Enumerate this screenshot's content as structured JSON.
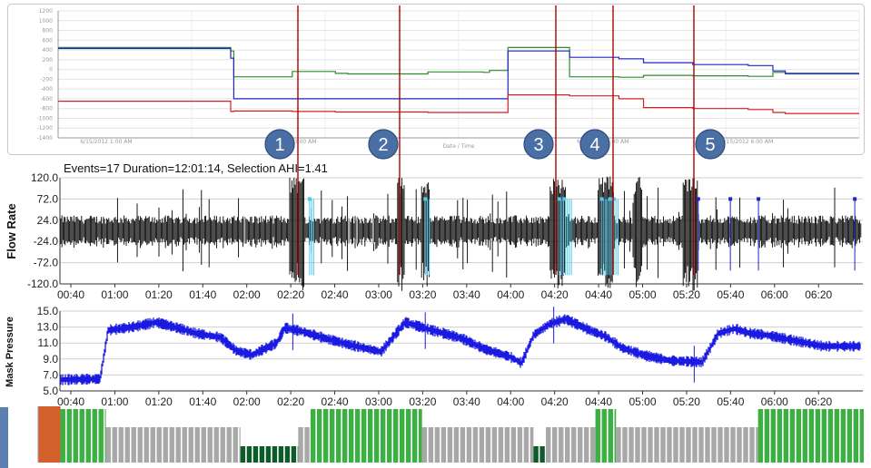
{
  "colors": {
    "green": "#2e8b2e",
    "blue": "#2323c8",
    "red": "#d42020",
    "flow": "#000000",
    "flow_event": "#4fc8e8",
    "mask": "#1a1ae0",
    "marker_line": "#b00000",
    "bar_green": "#3cb043",
    "bar_gray": "#a8a8a8",
    "bar_dark": "#0e5a2a",
    "bar_orange": "#d2602a",
    "marker_circle": "#4a6fa5"
  },
  "markers": [
    "1",
    "2",
    "3",
    "4",
    "5"
  ],
  "stats_text": "Events=17 Duration=12:01:14, Selection AHI=1.41",
  "chart_data": [
    {
      "type": "line",
      "name": "top-position-chart",
      "xlabel": "Date / Time",
      "ylim": [
        -1400,
        1200
      ],
      "y_ticks": [
        "1200",
        "1000",
        "800",
        "600",
        "400",
        "200",
        "0",
        "-200",
        "-400",
        "-600",
        "-800",
        "-1000",
        "-1200",
        "-1400"
      ],
      "x_ticks": [
        "6/15/2012 1:00 AM",
        "6/15/2012 3:00 AM",
        "6/15/2012 5:00 AM",
        "6/15/2012 6:00 AM"
      ],
      "x_range": [
        0,
        100
      ],
      "grid": true,
      "series": [
        {
          "color": "green",
          "points": [
            [
              0,
              450
            ],
            [
              28,
              450
            ],
            [
              28,
              380
            ],
            [
              28.5,
              380
            ],
            [
              28.5,
              -150
            ],
            [
              38,
              -150
            ],
            [
              38,
              -40
            ],
            [
              45,
              -40
            ],
            [
              45,
              -80
            ],
            [
              47,
              -80
            ],
            [
              47,
              -90
            ],
            [
              60,
              -90
            ],
            [
              60,
              -50
            ],
            [
              69,
              -50
            ],
            [
              69,
              -60
            ],
            [
              70,
              -60
            ],
            [
              70,
              -20
            ],
            [
              73,
              -20
            ],
            [
              73,
              450
            ],
            [
              83,
              450
            ],
            [
              83,
              -150
            ],
            [
              91,
              -150
            ],
            [
              91,
              -160
            ],
            [
              95,
              -160
            ],
            [
              95,
              -120
            ],
            [
              103,
              -120
            ],
            [
              103,
              -130
            ],
            [
              112,
              -130
            ],
            [
              112,
              -140
            ],
            [
              116,
              -140
            ],
            [
              116,
              -60
            ],
            [
              118,
              -60
            ],
            [
              118,
              -90
            ],
            [
              130,
              -90
            ]
          ]
        },
        {
          "color": "blue",
          "points": [
            [
              0,
              430
            ],
            [
              28,
              430
            ],
            [
              28,
              230
            ],
            [
              28.5,
              230
            ],
            [
              28.5,
              -600
            ],
            [
              38,
              -600
            ],
            [
              38,
              -600
            ],
            [
              45,
              -600
            ],
            [
              45,
              -600
            ],
            [
              47,
              -600
            ],
            [
              60,
              -600
            ],
            [
              60,
              -600
            ],
            [
              69,
              -600
            ],
            [
              70,
              -600
            ],
            [
              73,
              -600
            ],
            [
              73,
              380
            ],
            [
              83,
              380
            ],
            [
              83,
              250
            ],
            [
              91,
              250
            ],
            [
              91,
              220
            ],
            [
              95,
              220
            ],
            [
              95,
              140
            ],
            [
              103,
              140
            ],
            [
              103,
              100
            ],
            [
              112,
              100
            ],
            [
              112,
              80
            ],
            [
              116,
              80
            ],
            [
              116,
              -30
            ],
            [
              118,
              -30
            ],
            [
              118,
              -80
            ],
            [
              130,
              -80
            ]
          ]
        },
        {
          "color": "red",
          "points": [
            [
              0,
              -650
            ],
            [
              28,
              -650
            ],
            [
              28,
              -860
            ],
            [
              28.5,
              -860
            ],
            [
              28.5,
              -850
            ],
            [
              38,
              -850
            ],
            [
              38,
              -860
            ],
            [
              45,
              -860
            ],
            [
              45,
              -870
            ],
            [
              47,
              -870
            ],
            [
              60,
              -870
            ],
            [
              60,
              -880
            ],
            [
              69,
              -880
            ],
            [
              70,
              -880
            ],
            [
              73,
              -880
            ],
            [
              73,
              -520
            ],
            [
              83,
              -520
            ],
            [
              83,
              -540
            ],
            [
              91,
              -540
            ],
            [
              91,
              -600
            ],
            [
              95,
              -600
            ],
            [
              95,
              -780
            ],
            [
              103,
              -780
            ],
            [
              103,
              -800
            ],
            [
              112,
              -800
            ],
            [
              112,
              -820
            ],
            [
              116,
              -820
            ],
            [
              116,
              -880
            ],
            [
              118,
              -880
            ],
            [
              118,
              -900
            ],
            [
              130,
              -900
            ]
          ]
        }
      ],
      "marker_x": [
        0.343,
        0.462,
        0.645,
        0.712,
        0.817
      ]
    },
    {
      "type": "line",
      "name": "flow-rate-chart",
      "ylabel": "Flow Rate",
      "ylim": [
        -120,
        120
      ],
      "y_ticks": [
        "120.0",
        "72.0",
        "24.0",
        "-24.0",
        "-72.0",
        "-120.0"
      ],
      "x_ticks": [
        "00:40",
        "01:00",
        "01:20",
        "01:40",
        "02:00",
        "02:20",
        "02:40",
        "03:00",
        "03:20",
        "03:40",
        "04:00",
        "04:20",
        "04:40",
        "05:00",
        "05:20",
        "05:40",
        "06:00",
        "06:20"
      ],
      "grid": true
    },
    {
      "type": "line",
      "name": "mask-pressure-chart",
      "ylabel": "Mask Pressure",
      "ylim": [
        5,
        15
      ],
      "y_ticks": [
        "15.0",
        "13.0",
        "11.0",
        "9.0",
        "7.0",
        "5.0"
      ],
      "x_ticks": [
        "00:40",
        "01:00",
        "01:20",
        "01:40",
        "02:00",
        "02:20",
        "02:40",
        "03:00",
        "03:20",
        "03:40",
        "04:00",
        "04:20",
        "04:40",
        "05:00",
        "05:20",
        "05:40",
        "06:00",
        "06:20"
      ],
      "grid": true,
      "series": [
        {
          "color": "mask",
          "points": [
            [
              0,
              6.4
            ],
            [
              0.05,
              6.5
            ],
            [
              0.06,
              12.6
            ],
            [
              0.09,
              13.0
            ],
            [
              0.12,
              13.6
            ],
            [
              0.15,
              12.8
            ],
            [
              0.17,
              12.2
            ],
            [
              0.2,
              11.7
            ],
            [
              0.22,
              10.0
            ],
            [
              0.24,
              9.5
            ],
            [
              0.245,
              9.8
            ],
            [
              0.27,
              11.0
            ],
            [
              0.28,
              12.9
            ],
            [
              0.3,
              12.5
            ],
            [
              0.33,
              11.6
            ],
            [
              0.36,
              10.8
            ],
            [
              0.4,
              9.9
            ],
            [
              0.43,
              13.6
            ],
            [
              0.46,
              12.7
            ],
            [
              0.5,
              11.6
            ],
            [
              0.53,
              10.2
            ],
            [
              0.56,
              9.3
            ],
            [
              0.575,
              8.5
            ],
            [
              0.59,
              12.0
            ],
            [
              0.61,
              13.4
            ],
            [
              0.63,
              14.0
            ],
            [
              0.66,
              12.6
            ],
            [
              0.68,
              11.8
            ],
            [
              0.7,
              10.4
            ],
            [
              0.73,
              9.4
            ],
            [
              0.76,
              8.8
            ],
            [
              0.8,
              8.6
            ],
            [
              0.82,
              12.2
            ],
            [
              0.84,
              12.8
            ],
            [
              0.86,
              12.2
            ],
            [
              0.88,
              12.0
            ],
            [
              0.9,
              11.6
            ],
            [
              0.92,
              11.2
            ],
            [
              0.95,
              10.6
            ]
          ]
        }
      ]
    },
    {
      "type": "bar",
      "name": "position-bar-chart",
      "segments": [
        {
          "color": "bar_orange",
          "from": 0.0,
          "to": 0.027
        },
        {
          "color": "bar_green",
          "from": 0.027,
          "to": 0.082
        },
        {
          "color": "bar_gray",
          "from": 0.082,
          "to": 0.245
        },
        {
          "color": "bar_dark",
          "from": 0.245,
          "to": 0.315
        },
        {
          "color": "bar_gray",
          "from": 0.315,
          "to": 0.33
        },
        {
          "color": "bar_green",
          "from": 0.33,
          "to": 0.465
        },
        {
          "color": "bar_gray",
          "from": 0.465,
          "to": 0.6
        },
        {
          "color": "bar_dark",
          "from": 0.6,
          "to": 0.615
        },
        {
          "color": "bar_gray",
          "from": 0.615,
          "to": 0.675
        },
        {
          "color": "bar_green",
          "from": 0.675,
          "to": 0.7
        },
        {
          "color": "bar_gray",
          "from": 0.7,
          "to": 0.872
        },
        {
          "color": "bar_green",
          "from": 0.872,
          "to": 1.0
        }
      ]
    }
  ]
}
